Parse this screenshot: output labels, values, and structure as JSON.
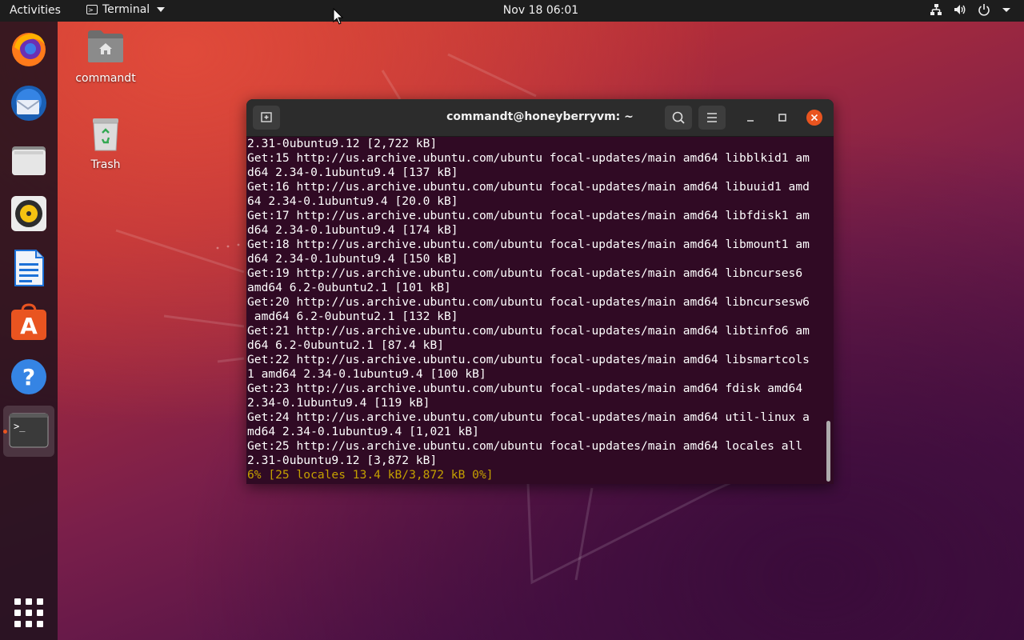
{
  "topbar": {
    "activities": "Activities",
    "app_name": "Terminal",
    "clock": "Nov 18  06:01",
    "icons": [
      "network-icon",
      "volume-icon",
      "power-icon",
      "system-menu-chevron-icon"
    ]
  },
  "dock": {
    "items": [
      {
        "name": "firefox",
        "icon": "firefox-icon"
      },
      {
        "name": "thunderbird",
        "icon": "thunderbird-icon"
      },
      {
        "name": "files",
        "icon": "files-icon"
      },
      {
        "name": "rhythmbox",
        "icon": "rhythmbox-icon"
      },
      {
        "name": "libreoffice-writer",
        "icon": "writer-icon"
      },
      {
        "name": "ubuntu-software",
        "icon": "software-icon"
      },
      {
        "name": "help",
        "icon": "help-icon"
      },
      {
        "name": "terminal",
        "icon": "terminal-icon",
        "active": true
      }
    ],
    "show_apps_icon": "apps-grid-icon"
  },
  "desktop": {
    "home_label": "commandt",
    "trash_label": "Trash"
  },
  "terminal": {
    "title": "commandt@honeyberryvm: ~",
    "lines": [
      "2.31-0ubuntu9.12 [2,722 kB]",
      "Get:15 http://us.archive.ubuntu.com/ubuntu focal-updates/main amd64 libblkid1 am",
      "d64 2.34-0.1ubuntu9.4 [137 kB]",
      "Get:16 http://us.archive.ubuntu.com/ubuntu focal-updates/main amd64 libuuid1 amd",
      "64 2.34-0.1ubuntu9.4 [20.0 kB]",
      "Get:17 http://us.archive.ubuntu.com/ubuntu focal-updates/main amd64 libfdisk1 am",
      "d64 2.34-0.1ubuntu9.4 [174 kB]",
      "Get:18 http://us.archive.ubuntu.com/ubuntu focal-updates/main amd64 libmount1 am",
      "d64 2.34-0.1ubuntu9.4 [150 kB]",
      "Get:19 http://us.archive.ubuntu.com/ubuntu focal-updates/main amd64 libncurses6",
      "amd64 6.2-0ubuntu2.1 [101 kB]",
      "Get:20 http://us.archive.ubuntu.com/ubuntu focal-updates/main amd64 libncursesw6",
      " amd64 6.2-0ubuntu2.1 [132 kB]",
      "Get:21 http://us.archive.ubuntu.com/ubuntu focal-updates/main amd64 libtinfo6 am",
      "d64 6.2-0ubuntu2.1 [87.4 kB]",
      "Get:22 http://us.archive.ubuntu.com/ubuntu focal-updates/main amd64 libsmartcols",
      "1 amd64 2.34-0.1ubuntu9.4 [100 kB]",
      "Get:23 http://us.archive.ubuntu.com/ubuntu focal-updates/main amd64 fdisk amd64",
      "2.34-0.1ubuntu9.4 [119 kB]",
      "Get:24 http://us.archive.ubuntu.com/ubuntu focal-updates/main amd64 util-linux a",
      "md64 2.34-0.1ubuntu9.4 [1,021 kB]",
      "Get:25 http://us.archive.ubuntu.com/ubuntu focal-updates/main amd64 locales all",
      "2.31-0ubuntu9.12 [3,872 kB]"
    ],
    "progress": "6% [25 locales 13.4 kB/3,872 kB 0%]"
  },
  "colors": {
    "terminal_bg": "#300a24",
    "progress_text": "#c4a000",
    "accent": "#e95420"
  }
}
